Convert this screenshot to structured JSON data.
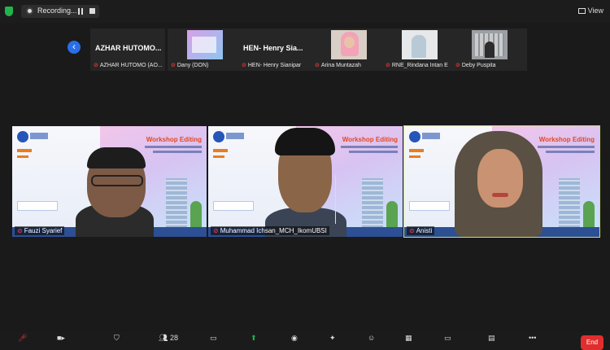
{
  "recording": {
    "label": "Recording..."
  },
  "view": {
    "label": "View"
  },
  "strip": {
    "thumbs": [
      {
        "display_name": "AZHAR  HUTOMO...",
        "name": "AZHAR HUTOMO (AO..."
      },
      {
        "display_name": "",
        "name": "Dany (DON)"
      },
      {
        "display_name": "HEN- Henry Sia...",
        "name": "HEN- Henry Sianipar"
      },
      {
        "display_name": "",
        "name": "Arina Muntazah"
      },
      {
        "display_name": "",
        "name": "RNE_Rindana Intan E"
      },
      {
        "display_name": "",
        "name": "Deby Puspita"
      }
    ]
  },
  "tiles": [
    {
      "name": "Fauzi Syarief",
      "slide_title": "Workshop Editing"
    },
    {
      "name": "Muhammad Ichsan_MCH_IkomUBSI",
      "slide_title": "Workshop Editing"
    },
    {
      "name": "Anisti",
      "slide_title": "Workshop Editing"
    }
  ],
  "toolbar": {
    "participants_count": "28",
    "end_label": "End"
  },
  "colors": {
    "active_speaker": "#cfe63a",
    "mic_off": "#e03a3a",
    "share": "#22b34c",
    "end": "#e02e2e"
  }
}
